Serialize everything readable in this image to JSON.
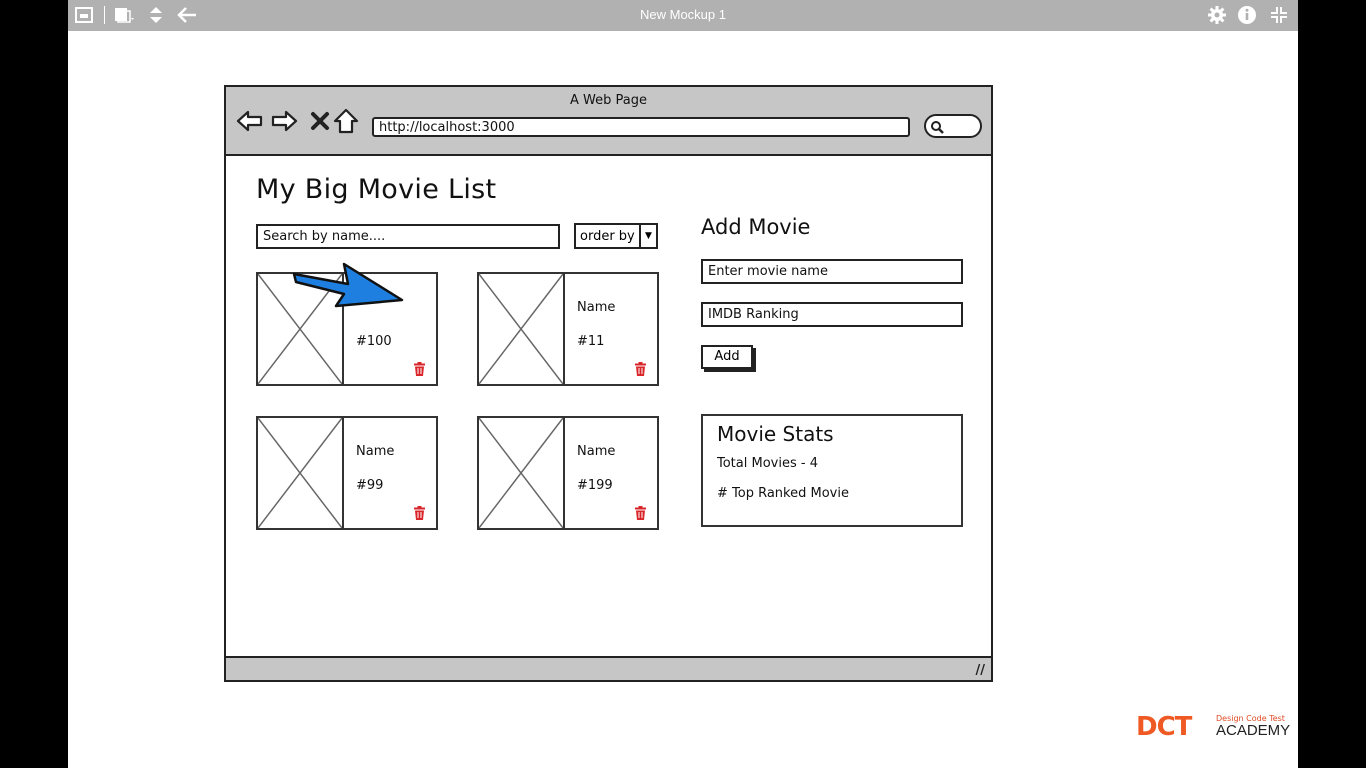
{
  "app": {
    "title": "New Mockup 1"
  },
  "browser": {
    "page_title": "A Web Page",
    "url": "http://localhost:3000"
  },
  "page": {
    "heading": "My Big Movie List",
    "search_placeholder": "Search by name....",
    "order_label": "order by"
  },
  "movies": [
    {
      "name": "",
      "rank": "#100"
    },
    {
      "name": "Name",
      "rank": "#11"
    },
    {
      "name": "Name",
      "rank": "#99"
    },
    {
      "name": "Name",
      "rank": "#199"
    }
  ],
  "add_movie": {
    "heading": "Add Movie",
    "name_placeholder": "Enter movie name",
    "ranking_placeholder": "IMDB Ranking",
    "button_label": "Add"
  },
  "stats": {
    "title": "Movie Stats",
    "total": "Total Movies - 4",
    "top": "# Top Ranked Movie"
  },
  "watermark": {
    "brand": "DCT",
    "tagline": "Design Code Test",
    "academy": "ACADEMY"
  },
  "colors": {
    "accent_arrow": "#1e7fe0",
    "trash_red": "#d9262a",
    "toolbar_gray": "#b1b1b1",
    "chrome_gray": "#c6c6c6",
    "brand_orange": "#ef5a24"
  }
}
